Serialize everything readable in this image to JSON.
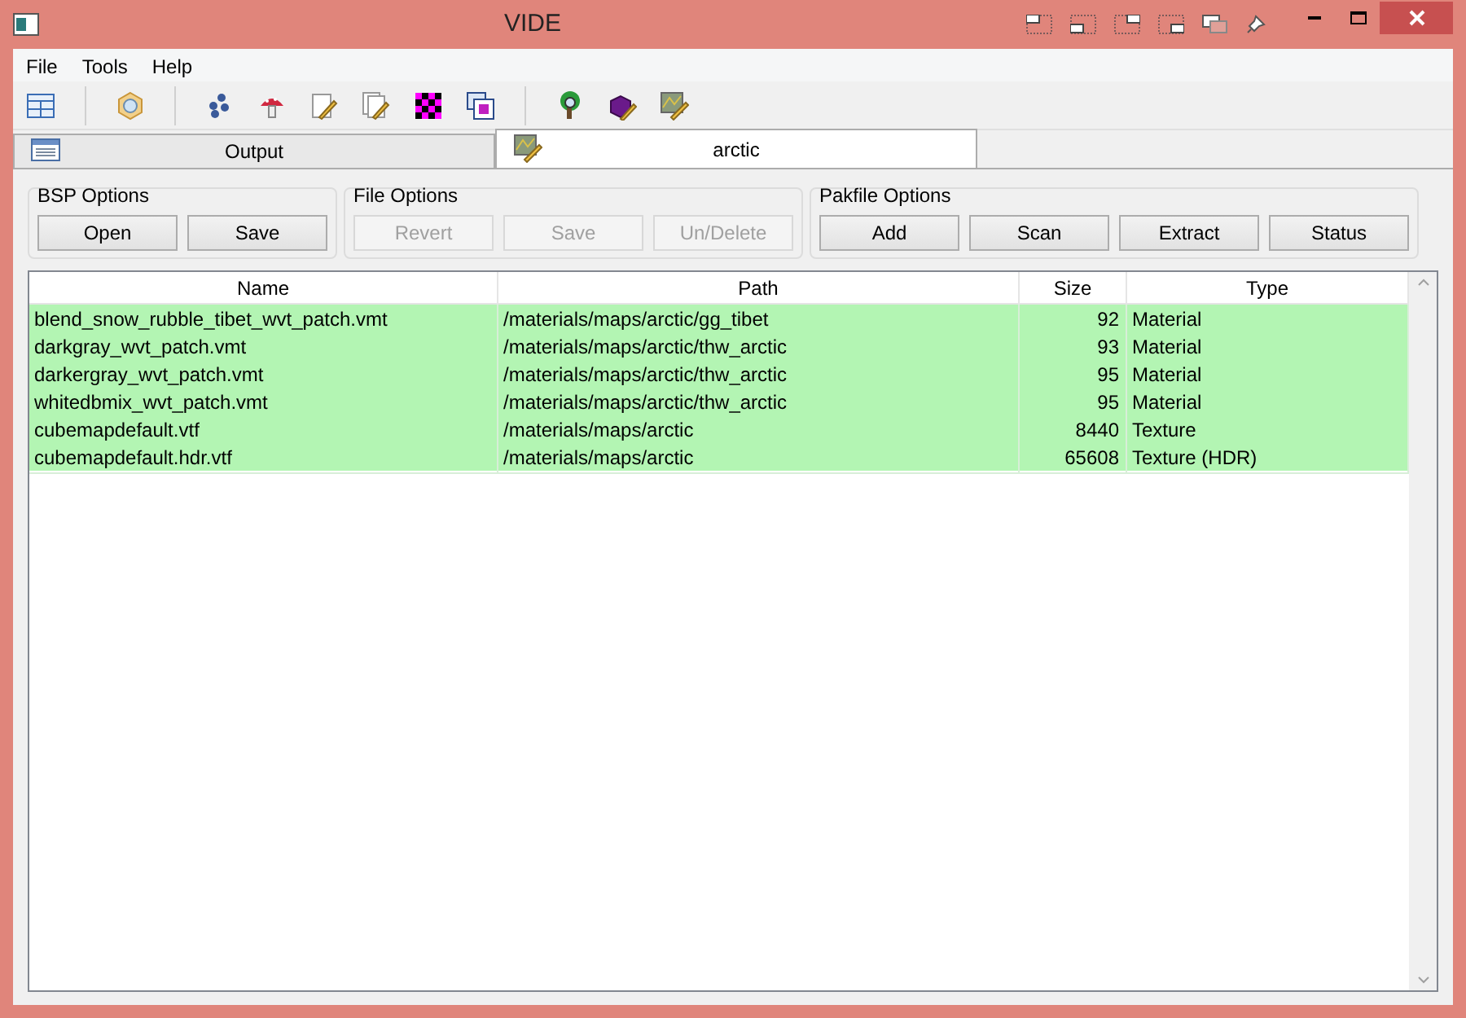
{
  "window": {
    "title": "VIDE"
  },
  "menu": [
    "File",
    "Tools",
    "Help"
  ],
  "tabs": [
    {
      "label": "Output",
      "selected": false,
      "kind": "list"
    },
    {
      "label": "arctic",
      "selected": true,
      "kind": "map"
    }
  ],
  "groups": [
    {
      "title": "BSP Options",
      "buttons": [
        {
          "label": "Open",
          "disabled": false
        },
        {
          "label": "Save",
          "disabled": false
        }
      ]
    },
    {
      "title": "File Options",
      "buttons": [
        {
          "label": "Revert",
          "disabled": true
        },
        {
          "label": "Save",
          "disabled": true
        },
        {
          "label": "Un/Delete",
          "disabled": true
        }
      ]
    },
    {
      "title": "Pakfile Options",
      "buttons": [
        {
          "label": "Add",
          "disabled": false
        },
        {
          "label": "Scan",
          "disabled": false
        },
        {
          "label": "Extract",
          "disabled": false
        },
        {
          "label": "Status",
          "disabled": false
        }
      ]
    }
  ],
  "table": {
    "columns": [
      "Name",
      "Path",
      "Size",
      "Type"
    ],
    "rows": [
      [
        "blend_snow_rubble_tibet_wvt_patch.vmt",
        "/materials/maps/arctic/gg_tibet",
        "92",
        "Material"
      ],
      [
        "darkgray_wvt_patch.vmt",
        "/materials/maps/arctic/thw_arctic",
        "93",
        "Material"
      ],
      [
        "darkergray_wvt_patch.vmt",
        "/materials/maps/arctic/thw_arctic",
        "95",
        "Material"
      ],
      [
        "whitedbmix_wvt_patch.vmt",
        "/materials/maps/arctic/thw_arctic",
        "95",
        "Material"
      ],
      [
        "cubemapdefault.vtf",
        "/materials/maps/arctic",
        "8440",
        "Texture"
      ],
      [
        "cubemapdefault.hdr.vtf",
        "/materials/maps/arctic",
        "65608",
        "Texture (HDR)"
      ]
    ]
  }
}
